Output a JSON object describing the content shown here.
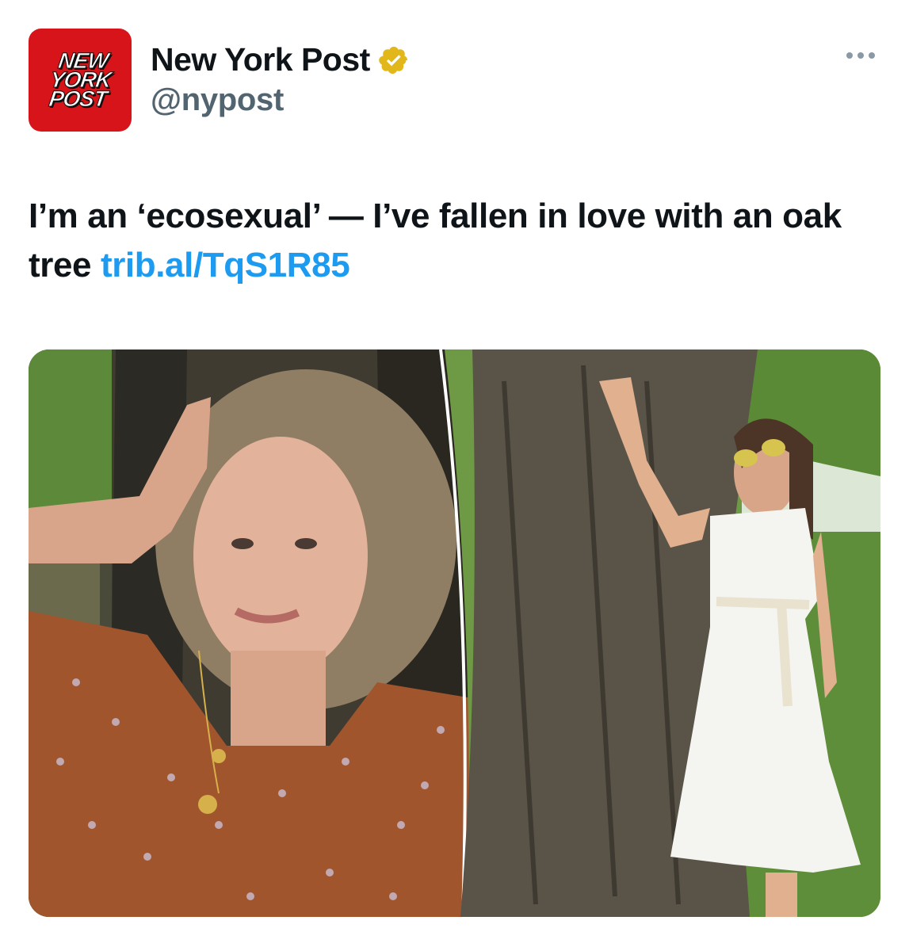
{
  "account": {
    "logo_lines": [
      "NEW",
      "YORK",
      "POST"
    ],
    "display_name": "New York Post",
    "handle": "@nypost",
    "verified_icon": "gold-verified-badge",
    "brand_color": "#d7141a"
  },
  "tweet": {
    "text": "I’m an ‘ecosexual’ — I’ve fallen in love with an oak tree",
    "link": "trib.al/TqS1R85",
    "link_color": "#1d9bf0"
  },
  "media": {
    "photo_count": 2
  },
  "icons": {
    "more": "more-horizontal-icon"
  }
}
